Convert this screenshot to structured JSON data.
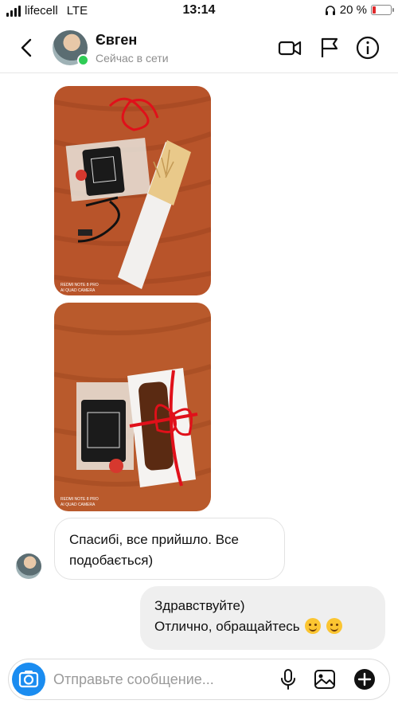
{
  "status_bar": {
    "carrier": "lifecell",
    "network": "LTE",
    "time": "13:14",
    "battery_text": "20 %",
    "battery_level": 0.2,
    "battery_color": "#e0292b"
  },
  "header": {
    "back_icon": "chevron-left-icon",
    "contact_name": "Євген",
    "contact_status": "Сейчас в сети",
    "online_color": "#2ecc55",
    "actions": [
      "video-call-icon",
      "flag-icon",
      "info-icon"
    ]
  },
  "messages": {
    "photo_1": {
      "watermark_line1": "REDMI NOTE 8 PRO",
      "watermark_line2": "AI QUAD CAMERA"
    },
    "photo_2": {
      "watermark_line1": "REDMI NOTE 8 PRO",
      "watermark_line2": "AI QUAD CAMERA"
    },
    "incoming_text": "Спасибі, все прийшло. Все подобається)",
    "outgoing_line1": "Здравствуйте)",
    "outgoing_line2": "Отлично, обращайтесь"
  },
  "composer": {
    "placeholder": "Отправьте сообщение...",
    "camera_color": "#1a8cf0",
    "icons": [
      "camera-icon",
      "microphone-icon",
      "gallery-icon",
      "plus-icon"
    ]
  }
}
